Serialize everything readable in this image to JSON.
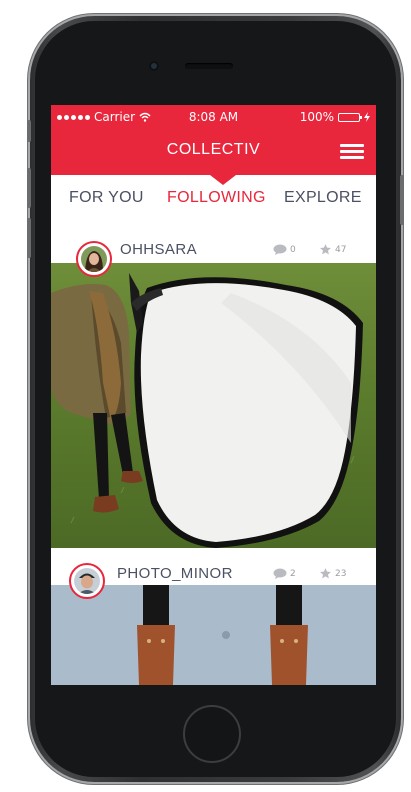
{
  "status_bar": {
    "carrier": "Carrier",
    "time": "8:08 AM",
    "battery": "100%"
  },
  "app": {
    "title": "COLLECTIV"
  },
  "tabs": [
    {
      "label": "FOR YOU",
      "active": false
    },
    {
      "label": "FOLLOWING",
      "active": true
    },
    {
      "label": "EXPLORE",
      "active": false
    }
  ],
  "posts": [
    {
      "username": "OHHSARA",
      "comments": "0",
      "stars": "47"
    },
    {
      "username": "PHOTO_MINOR",
      "comments": "2",
      "stars": "23"
    }
  ],
  "icons": {
    "signal": "signal-dots-icon",
    "wifi": "wifi-icon",
    "battery": "battery-icon",
    "menu": "hamburger-menu-icon",
    "comment": "comment-icon",
    "star": "star-icon"
  },
  "colors": {
    "accent": "#e8263c",
    "tab_text": "#4b5064",
    "stat_text": "#9a9ca4"
  }
}
